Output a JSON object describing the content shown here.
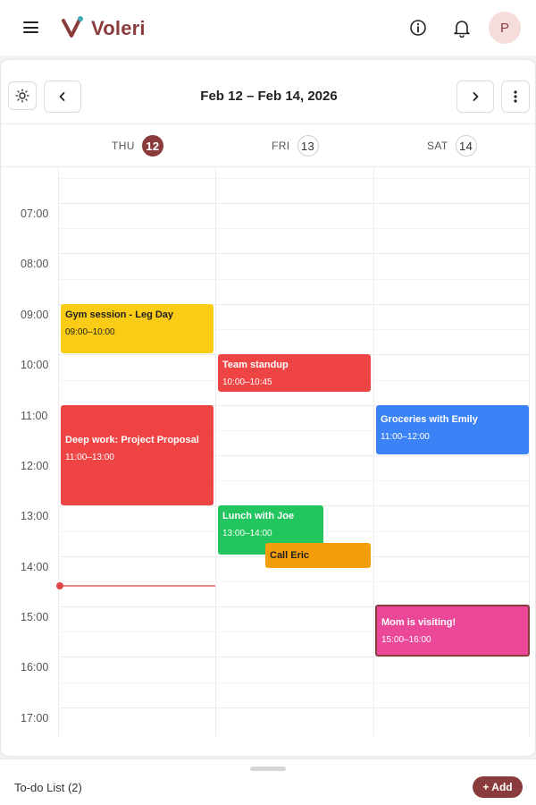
{
  "app": {
    "brand": "Voleri",
    "avatar_initial": "P"
  },
  "header": {
    "menu_icon": "hamburger-menu-icon",
    "info_icon": "info-icon",
    "bell_icon": "bell-icon"
  },
  "toolbar": {
    "range_title": "Feb 12 – Feb 14, 2026",
    "theme_icon": "sun-icon",
    "prev_icon": "chevron-left-icon",
    "next_icon": "chevron-right-icon",
    "more_icon": "more-vertical-icon"
  },
  "days": [
    {
      "weekday": "THU",
      "date": "12",
      "today": true
    },
    {
      "weekday": "FRI",
      "date": "13",
      "today": false
    },
    {
      "weekday": "SAT",
      "date": "14",
      "today": false
    }
  ],
  "time_labels": [
    "07:00",
    "08:00",
    "09:00",
    "10:00",
    "11:00",
    "12:00",
    "13:00",
    "14:00",
    "15:00",
    "16:00",
    "17:00"
  ],
  "events": [
    {
      "title": "Gym session - Leg Day",
      "time": "09:00–10:00",
      "color": "#facc15",
      "text_color": "#1f1f1f"
    },
    {
      "title": "Deep work: Project Proposal",
      "time": "11:00–13:00",
      "color": "#ef4444",
      "text_color": "#ffffff"
    },
    {
      "title": "Team standup",
      "time": "10:00–10:45",
      "color": "#ef4444",
      "text_color": "#ffffff"
    },
    {
      "title": "Lunch with Joe",
      "time": "13:00–14:00",
      "color": "#22c55e",
      "text_color": "#ffffff"
    },
    {
      "title": "Call Eric",
      "time": "",
      "color": "#f59e0b",
      "text_color": "#1f1f1f"
    },
    {
      "title": "Groceries with Emily",
      "time": "11:00–12:00",
      "color": "#3b82f6",
      "text_color": "#ffffff"
    },
    {
      "title": "Mom is visiting!",
      "time": "15:00–16:00",
      "color": "#ec4899",
      "text_color": "#ffffff"
    }
  ],
  "todo": {
    "label": "To-do List (2)",
    "add_label": "+ Add"
  },
  "colors": {
    "brand": "#8a3b3b",
    "now_indicator": "#e04848"
  }
}
